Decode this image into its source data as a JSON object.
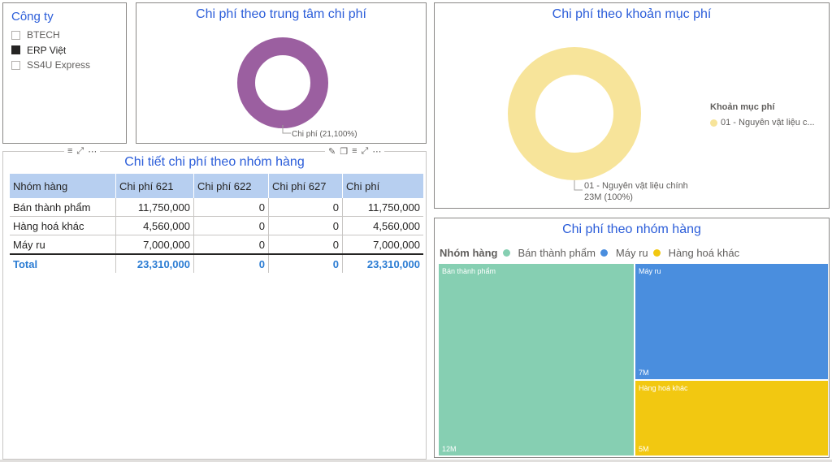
{
  "slicer": {
    "title": "Công ty",
    "items": [
      {
        "label": "BTECH",
        "checked": false
      },
      {
        "label": "ERP Việt",
        "checked": true
      },
      {
        "label": "SS4U Express",
        "checked": false
      }
    ]
  },
  "center_donut": {
    "title": "Chi phí theo trung tâm chi phí",
    "data_label": "Chi phí (21,100%)",
    "color": "#9b5fa0"
  },
  "detail": {
    "title": "Chi tiết chi phí theo nhóm hàng",
    "columns": [
      "Nhóm hàng",
      "Chi phí 621",
      "Chi phí 622",
      "Chi phí 627",
      "Chi phí"
    ],
    "rows": [
      [
        "Bán thành phẩm",
        "11,750,000",
        "0",
        "0",
        "11,750,000"
      ],
      [
        "Hàng hoá khác",
        "4,560,000",
        "0",
        "0",
        "4,560,000"
      ],
      [
        "Máy ru",
        "7,000,000",
        "0",
        "0",
        "7,000,000"
      ]
    ],
    "total": [
      "Total",
      "23,310,000",
      "0",
      "0",
      "23,310,000"
    ]
  },
  "item_donut": {
    "title": "Chi phí theo khoản mục phí",
    "legend_title": "Khoản mục phí",
    "legend_item": "01 - Nguyên vật liệu c...",
    "data_label_1": "01 - Nguyên vật liệu chính",
    "data_label_2": "23M (100%)",
    "color": "#f7e49a"
  },
  "treemap": {
    "title": "Chi phí theo nhóm hàng",
    "legend_title": "Nhóm hàng",
    "legend": [
      {
        "label": "Bán thành phẩm",
        "color": "#86cfb2"
      },
      {
        "label": "Máy ru",
        "color": "#4a8ede"
      },
      {
        "label": "Hàng hoá khác",
        "color": "#f2c811"
      }
    ],
    "tiles": [
      {
        "label": "Bán thành phẩm",
        "value_label": "12M",
        "color": "#86cfb2"
      },
      {
        "label": "Máy ru",
        "value_label": "7M",
        "color": "#4a8ede"
      },
      {
        "label": "Hàng hoá khác",
        "value_label": "5M",
        "color": "#f2c811"
      }
    ]
  }
}
